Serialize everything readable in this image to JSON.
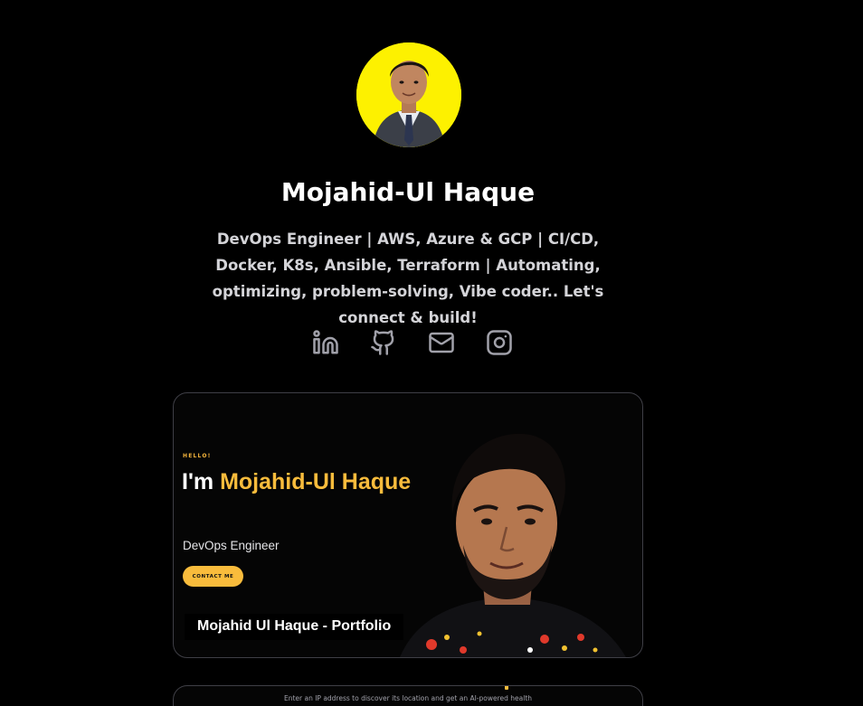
{
  "profile": {
    "name": "Mojahid-Ul Haque",
    "bio": "DevOps Engineer | AWS, Azure & GCP | CI/CD, Docker, K8s, Ansible, Terraform | Automating, optimizing, problem-solving, Vibe coder.. Let's connect & build!",
    "avatar_bg": "#fdf100"
  },
  "socials": [
    {
      "name": "linkedin-icon"
    },
    {
      "name": "github-icon"
    },
    {
      "name": "mail-icon"
    },
    {
      "name": "instagram-icon"
    }
  ],
  "card1": {
    "hello": "HELLO!",
    "title_prefix": "I'm ",
    "title_name": "Mojahid-Ul Haque",
    "role": "DevOps Engineer",
    "button": "CONTACT ME",
    "caption": "Mojahid Ul Haque - Portfolio",
    "accent": "#f9bc3c"
  },
  "card2": {
    "text": "Enter an IP address to discover its location and get an AI-powered health"
  }
}
